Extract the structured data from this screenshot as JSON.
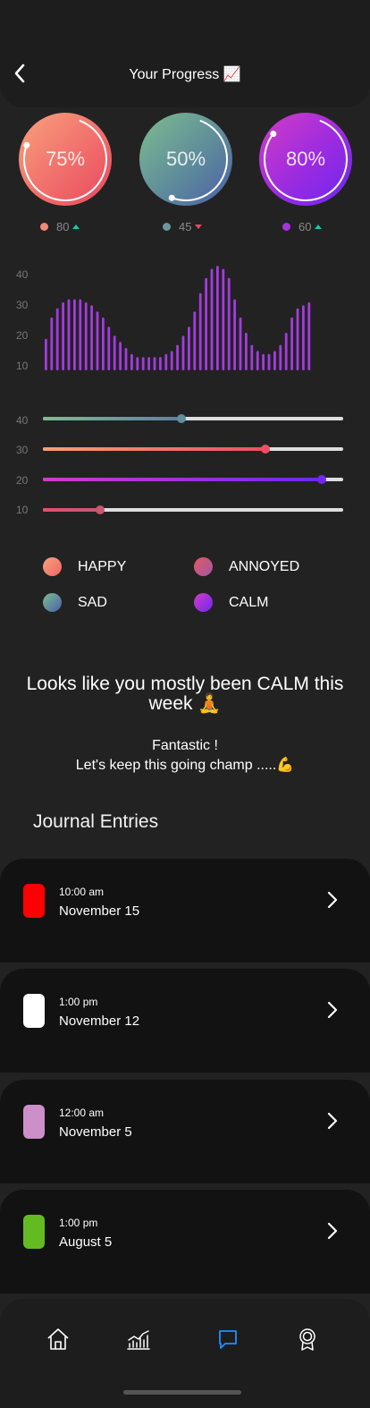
{
  "header": {
    "title": "Your Progress 📈",
    "back_icon": "back-arrow-icon"
  },
  "rings": [
    {
      "percent": "75%",
      "value": 0.75,
      "stat": "80",
      "trend": "up",
      "color": "#f08a78"
    },
    {
      "percent": "50%",
      "value": 0.5,
      "stat": "45",
      "trend": "down",
      "color": "#6a98a2"
    },
    {
      "percent": "80%",
      "value": 0.8,
      "stat": "60",
      "trend": "up",
      "color": "#a634d8"
    }
  ],
  "bar_chart": {
    "y_ticks": [
      "40",
      "30",
      "20",
      "10"
    ],
    "values": [
      18,
      25,
      28,
      30,
      31,
      31,
      31,
      30,
      29,
      27,
      25,
      22,
      19,
      17,
      15,
      13,
      12,
      12,
      12,
      12,
      12,
      13,
      14,
      16,
      19,
      22,
      27,
      33,
      38,
      41,
      42,
      41,
      38,
      31,
      25,
      20,
      16,
      14,
      13,
      13,
      14,
      16,
      20,
      25,
      28,
      29,
      30
    ],
    "color": "#a43be0"
  },
  "sliders": {
    "y_ticks": [
      "40",
      "30",
      "20",
      "10"
    ],
    "items": [
      {
        "value": 0.46,
        "gradient": [
          "#7dbd8f",
          "#5f7ea3"
        ],
        "thumb": "#5f8ea0"
      },
      {
        "value": 0.74,
        "gradient": [
          "#f7a072",
          "#ee4f63"
        ],
        "thumb": "#ee4f63"
      },
      {
        "value": 0.93,
        "gradient": [
          "#d23cc7",
          "#6b27f0"
        ],
        "thumb": "#7029ee"
      },
      {
        "value": 0.19,
        "gradient": [
          "#e0516a",
          "#c85576"
        ],
        "thumb": "#c8586c"
      }
    ]
  },
  "legend": [
    {
      "label": "HAPPY",
      "gradient": [
        "#f8a17c",
        "#ee6768"
      ]
    },
    {
      "label": "ANNOYED",
      "gradient": [
        "#e2595f",
        "#a456a8"
      ]
    },
    {
      "label": "SAD",
      "gradient": [
        "#7dbd8f",
        "#4a5fa8"
      ]
    },
    {
      "label": "CALM",
      "gradient": [
        "#d23cc7",
        "#7028ee"
      ]
    }
  ],
  "summary": {
    "headline": "Looks like you mostly been CALM this week 🧘",
    "line1": "Fantastic !",
    "line2": "Let's keep this going champ .....💪"
  },
  "journal": {
    "title": "Journal Entries",
    "entries": [
      {
        "time": "10:00 am",
        "date": "November 15",
        "color": "#ff0000"
      },
      {
        "time": "1:00 pm",
        "date": "November 12",
        "color": "#ffffff"
      },
      {
        "time": "12:00 am",
        "date": "November 5",
        "color": "#cc8fc8"
      },
      {
        "time": "1:00 pm",
        "date": "August 5",
        "color": "#63bb21"
      }
    ]
  },
  "nav": {
    "items": [
      "home-icon",
      "stats-icon",
      "journal-chat-icon",
      "award-icon"
    ],
    "active": "journal-chat-icon",
    "active_color": "#1e8fff",
    "inactive_color": "#ffffff"
  }
}
